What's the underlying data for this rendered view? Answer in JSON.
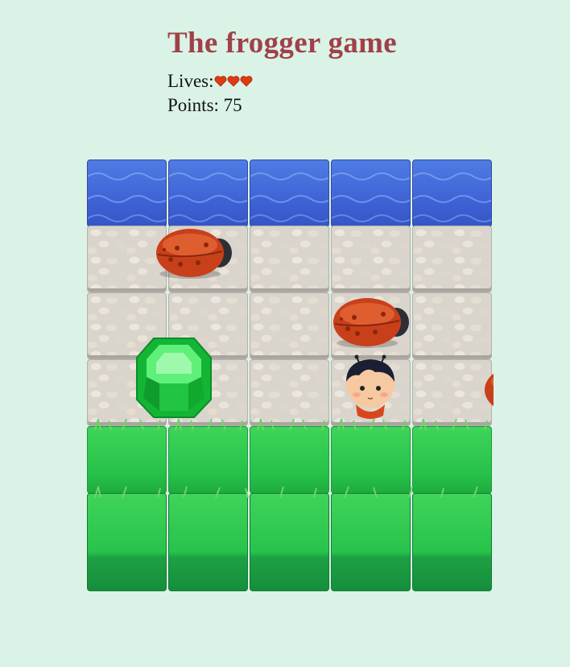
{
  "game": {
    "title": "The frogger game",
    "lives_label": "Lives:",
    "lives": 3,
    "points_label": "Points:",
    "points": "75"
  },
  "colors": {
    "background": "#dbf3e6",
    "title": "#a0414a",
    "heart": "#e03a12"
  },
  "board": {
    "columns": 5,
    "rows": [
      "water",
      "stone",
      "stone",
      "stone",
      "grass",
      "grass"
    ]
  },
  "sprites": {
    "enemies": [
      "red-bug",
      "red-bug",
      "red-bug"
    ],
    "collectible": "green-gem",
    "player": "boy-character"
  }
}
